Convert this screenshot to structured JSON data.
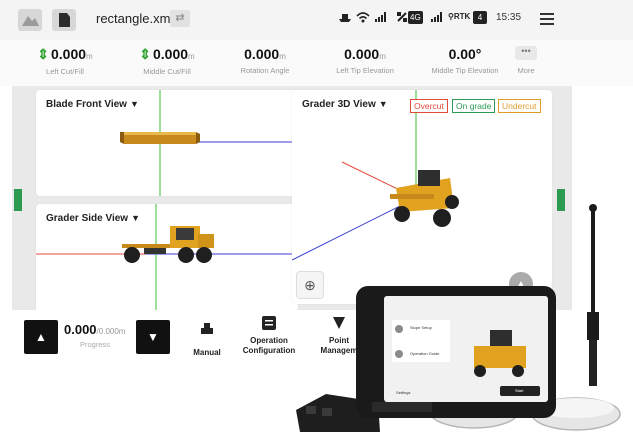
{
  "app": {
    "file_name": "rectangle.xml",
    "status": {
      "badge_a": "4G",
      "rtk_label": "RTK",
      "badge_b": "4",
      "time": "15:35"
    }
  },
  "readouts": [
    {
      "value": "0.000",
      "unit": "m",
      "label": "Left Cut/Fill",
      "show_arrow": true
    },
    {
      "value": "0.000",
      "unit": "m",
      "label": "Middle Cut/Fill",
      "show_arrow": true
    },
    {
      "value": "0.000",
      "unit": "m",
      "label": "Rotation Angle",
      "show_arrow": false
    },
    {
      "value": "0.000",
      "unit": "m",
      "label": "Left Tip Elevation",
      "show_arrow": false
    },
    {
      "value": "0.00°",
      "unit": "",
      "label": "Middle Tip Elevation",
      "show_arrow": false
    }
  ],
  "more": {
    "label": "More"
  },
  "views": {
    "front": {
      "title": "Blade Front View"
    },
    "side": {
      "title": "Grader Side View"
    },
    "three_d": {
      "title": "Grader 3D View"
    }
  },
  "legend": {
    "overcut": "Overcut",
    "on_grade": "On grade",
    "undercut": "Undercut"
  },
  "progress": {
    "value": "0.000",
    "total": "/0.000m",
    "label": "Progress"
  },
  "tools": {
    "manual": "Manual",
    "operation_line1": "Operation",
    "operation_line2": "Configuration",
    "point_line1": "Point",
    "point_line2": "Managem"
  },
  "device": {
    "card_title_a": "Slope Setup",
    "card_title_b": "Operation Guide",
    "footer_left": "Settings",
    "footer_right": "Start"
  },
  "colors": {
    "accent_green": "#2d9a52",
    "overcut": "#e24a3a",
    "on_grade": "#2a9a55",
    "undercut": "#e09b2a",
    "grader_body": "#e0a21f"
  }
}
